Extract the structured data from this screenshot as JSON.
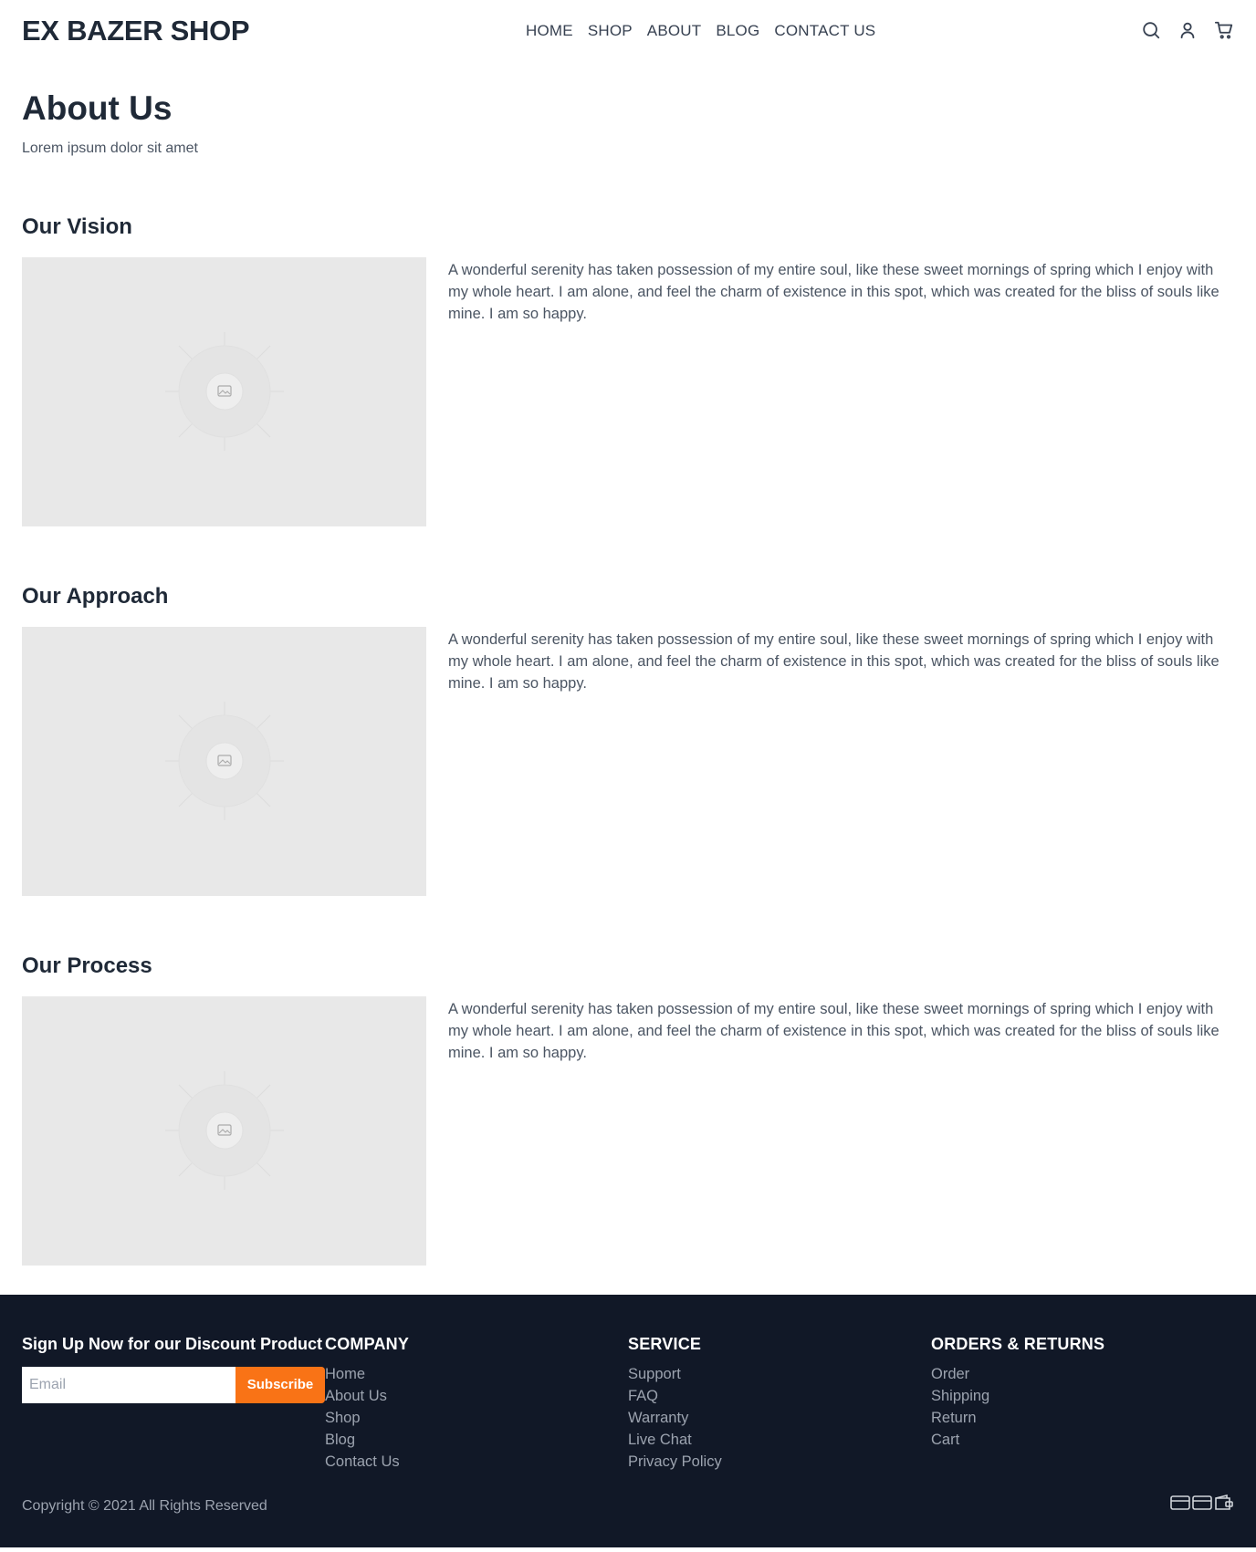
{
  "header": {
    "brand": "EX BAZER SHOP",
    "nav": [
      "HOME",
      "SHOP",
      "ABOUT",
      "BLOG",
      "CONTACT US"
    ],
    "icons": [
      "search-icon",
      "user-icon",
      "cart-icon"
    ]
  },
  "hero": {
    "title": "About Us",
    "subtitle": "Lorem ipsum dolor sit amet"
  },
  "sections": [
    {
      "title": "Our Vision",
      "body": "A wonderful serenity has taken possession of my entire soul, like these sweet mornings of spring which I enjoy with my whole heart. I am alone, and feel the charm of existence in this spot, which was created for the bliss of souls like mine. I am so happy."
    },
    {
      "title": "Our Approach",
      "body": "A wonderful serenity has taken possession of my entire soul, like these sweet mornings of spring which I enjoy with my whole heart. I am alone, and feel the charm of existence in this spot, which was created for the bliss of souls like mine. I am so happy."
    },
    {
      "title": "Our Process",
      "body": "A wonderful serenity has taken possession of my entire soul, like these sweet mornings of spring which I enjoy with my whole heart. I am alone, and feel the charm of existence in this spot, which was created for the bliss of souls like mine. I am so happy."
    }
  ],
  "footer": {
    "signup": {
      "title": "Sign Up Now for our Discount Product",
      "email_placeholder": "Email",
      "subscribe_label": "Subscribe"
    },
    "company": {
      "title": "COMPANY",
      "links": [
        "Home",
        "About Us",
        "Shop",
        "Blog",
        "Contact Us"
      ]
    },
    "service": {
      "title": "SERVICE",
      "links": [
        "Support",
        "FAQ",
        "Warranty",
        "Live Chat",
        "Privacy Policy"
      ]
    },
    "orders": {
      "title": "ORDERS & RETURNS",
      "links": [
        "Order",
        "Shipping",
        "Return",
        "Cart"
      ]
    },
    "copyright": "Copyright © 2021 All Rights Reserved",
    "payment_icons": [
      "credit-card-icon",
      "credit-card-icon",
      "wallet-icon"
    ]
  },
  "colors": {
    "dark": "#111827",
    "accent": "#f97316",
    "placeholder_bg": "#e8e8e8",
    "muted_text": "#9ca3af"
  }
}
